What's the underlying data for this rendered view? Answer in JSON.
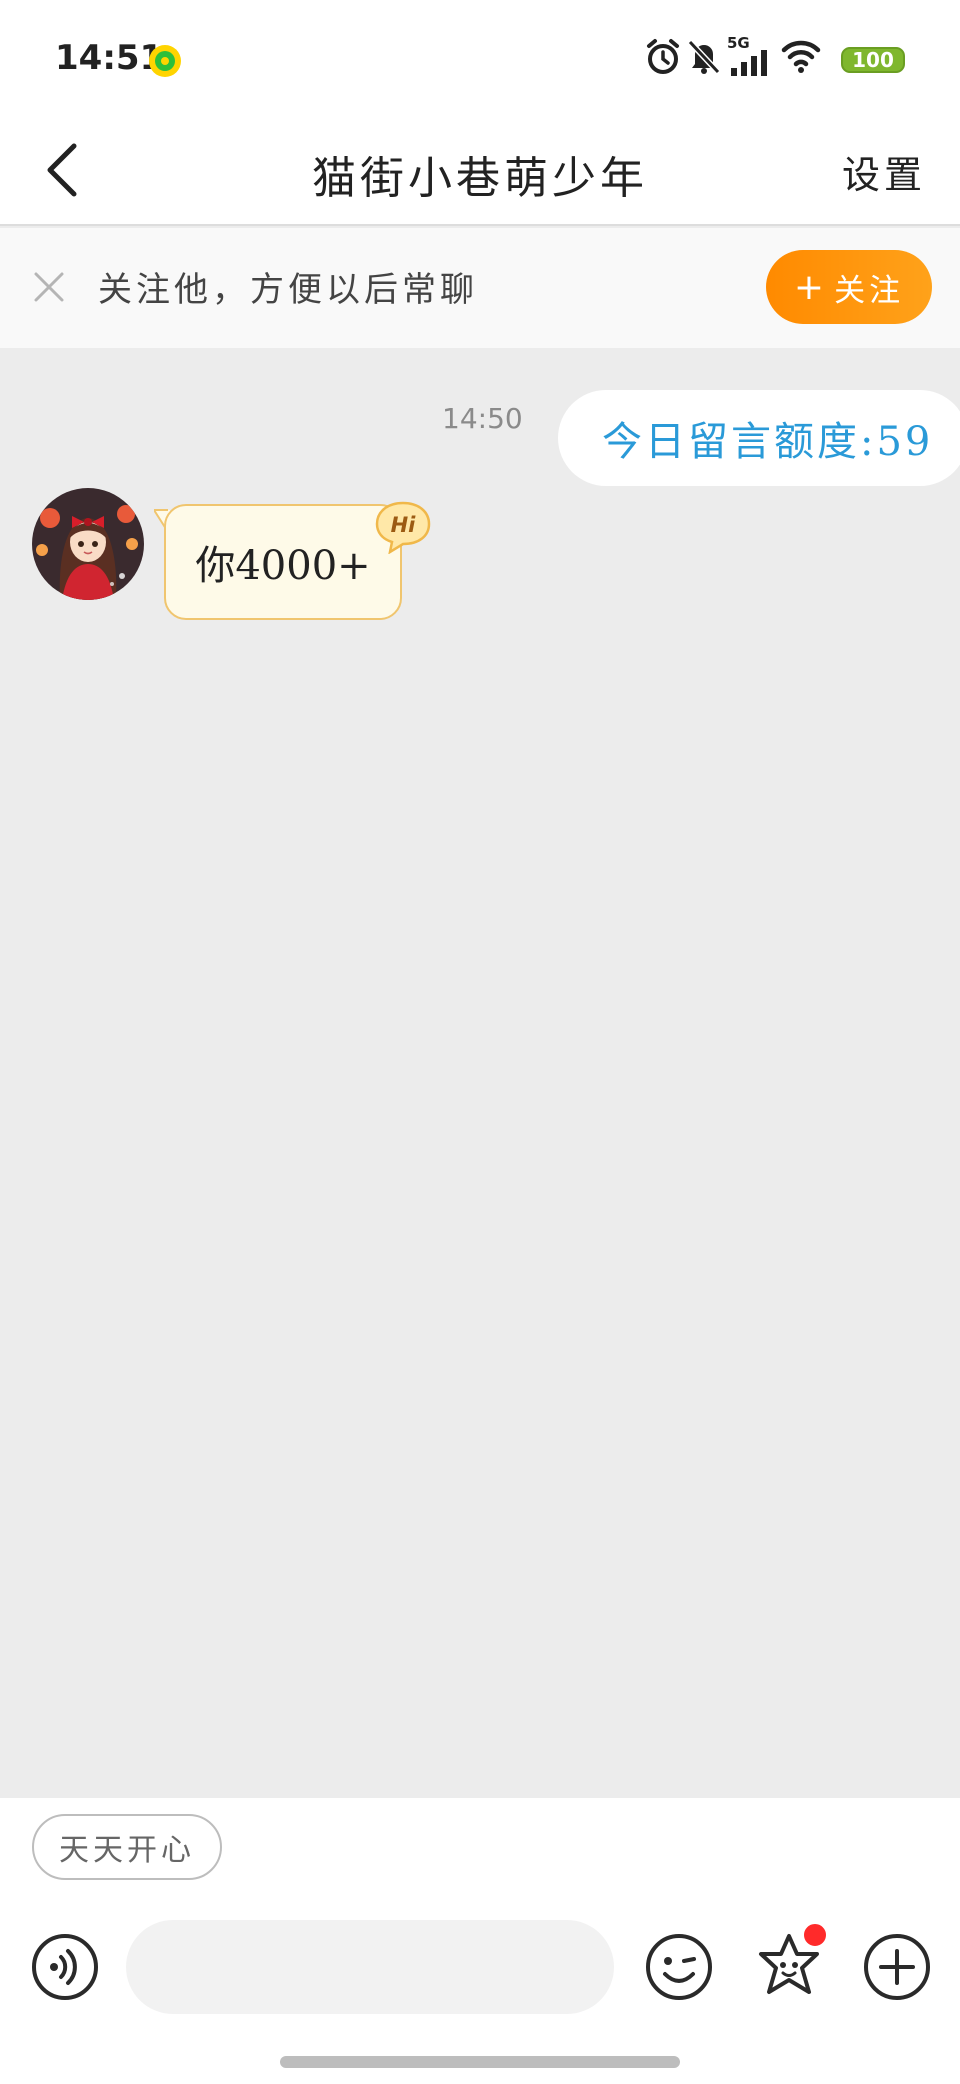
{
  "status_bar": {
    "time": "14:51",
    "network": "5G",
    "battery": "100",
    "icons": [
      "music-app-icon",
      "alarm-icon",
      "mute-icon",
      "signal-icon",
      "wifi-icon",
      "battery-icon"
    ]
  },
  "header": {
    "title": "猫街小巷萌少年",
    "settings_label": "设置"
  },
  "follow_banner": {
    "text": "关注他，方便以后常聊",
    "button_label": "关注",
    "button_plus": "+"
  },
  "chat": {
    "messages": [
      {
        "time": "14:50",
        "text": "今日留言额度:59",
        "side": "sent"
      },
      {
        "text": "你4000+",
        "side": "received",
        "badge": "Hi"
      }
    ]
  },
  "quick_reply": {
    "chip_label": "天天开心"
  },
  "input_bar": {
    "placeholder": "",
    "has_notification_dot": true
  },
  "colors": {
    "accent_orange": "#ff8a00",
    "link_blue": "#2a9ad8",
    "bubble_border": "#f0c56e",
    "notification_red": "#ff2a2a"
  }
}
